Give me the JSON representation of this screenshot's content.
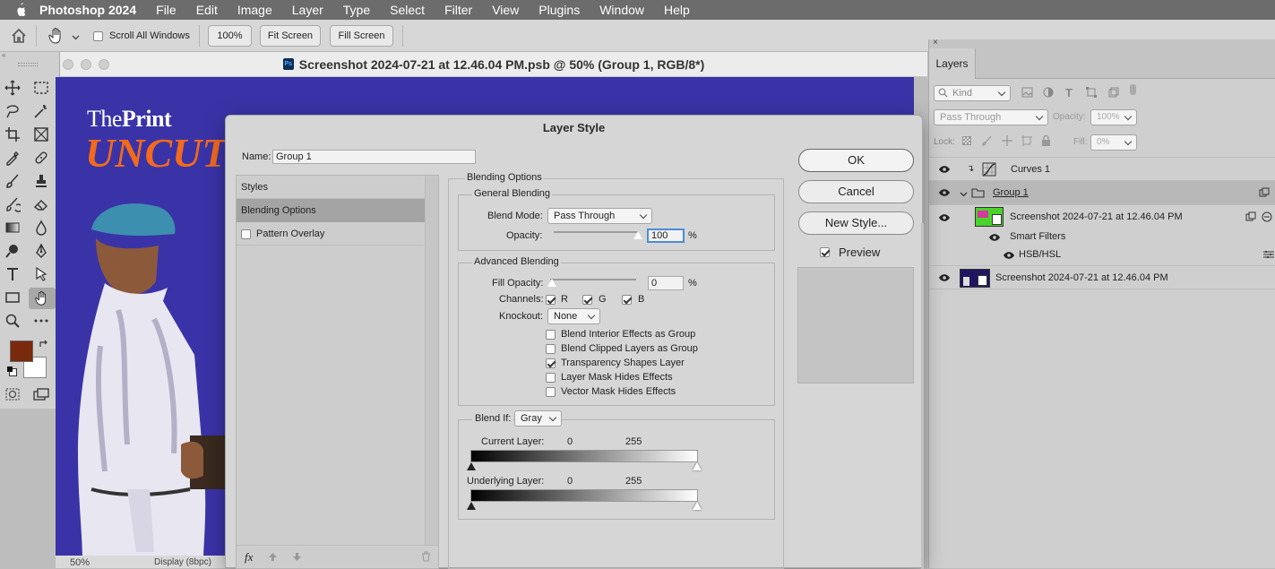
{
  "menubar": {
    "app_name": "Photoshop 2024",
    "items": [
      "File",
      "Edit",
      "Image",
      "Layer",
      "Type",
      "Select",
      "Filter",
      "View",
      "Plugins",
      "Window",
      "Help"
    ]
  },
  "options_bar": {
    "scroll_all_windows": "Scroll All Windows",
    "zoom_100": "100%",
    "fit_screen": "Fit Screen",
    "fill_screen": "Fill Screen"
  },
  "document": {
    "title": "Screenshot 2024-07-21 at 12.46.04 PM.psb @ 50% (Group 1, RGB/8*)",
    "brand_top_left": "The",
    "brand_top_right": "Print",
    "brand_sub": "UNCUT",
    "zoom": "50%",
    "display_info": "Display (8bpc)"
  },
  "colors": {
    "foreground": "#7a2a0c",
    "background": "#ffffff",
    "canvas": "#3a33a8",
    "brand_orange": "#f26a1b"
  },
  "layers_panel": {
    "tab": "Layers",
    "filter_kind": "Kind",
    "blend_mode": "Pass Through",
    "opacity_label": "Opacity:",
    "opacity_value": "100%",
    "lock_label": "Lock:",
    "fill_label": "Fill:",
    "fill_value": "0%",
    "layers": [
      {
        "name": "Curves 1"
      },
      {
        "name": "Group 1"
      },
      {
        "name": "Screenshot 2024-07-21 at 12.46.04 PM"
      },
      {
        "name": "Smart Filters"
      },
      {
        "name": "HSB/HSL"
      },
      {
        "name": "Screenshot 2024-07-21 at 12.46.04 PM"
      }
    ]
  },
  "dialog": {
    "title": "Layer Style",
    "name_label": "Name:",
    "name_value": "Group 1",
    "styles_list": [
      "Styles",
      "Blending Options",
      "Pattern Overlay"
    ],
    "blending_options_title": "Blending Options",
    "general_blending": "General Blending",
    "blend_mode_label": "Blend Mode:",
    "blend_mode_value": "Pass Through",
    "opacity_label": "Opacity:",
    "opacity_value": "100",
    "percent": "%",
    "advanced_blending": "Advanced Blending",
    "fill_opacity_label": "Fill Opacity:",
    "fill_opacity_value": "0",
    "channels_label": "Channels:",
    "channel_r": "R",
    "channel_g": "G",
    "channel_b": "B",
    "knockout_label": "Knockout:",
    "knockout_value": "None",
    "options": [
      {
        "label": "Blend Interior Effects as Group",
        "checked": false
      },
      {
        "label": "Blend Clipped Layers as Group",
        "checked": false
      },
      {
        "label": "Transparency Shapes Layer",
        "checked": true
      },
      {
        "label": "Layer Mask Hides Effects",
        "checked": false
      },
      {
        "label": "Vector Mask Hides Effects",
        "checked": false
      }
    ],
    "blend_if_label": "Blend If:",
    "blend_if_value": "Gray",
    "current_layer_label": "Current Layer:",
    "current_layer_min": "0",
    "current_layer_max": "255",
    "underlying_layer_label": "Underlying Layer:",
    "underlying_layer_min": "0",
    "underlying_layer_max": "255",
    "ok": "OK",
    "cancel": "Cancel",
    "new_style": "New Style...",
    "preview": "Preview",
    "fx": "fx"
  }
}
